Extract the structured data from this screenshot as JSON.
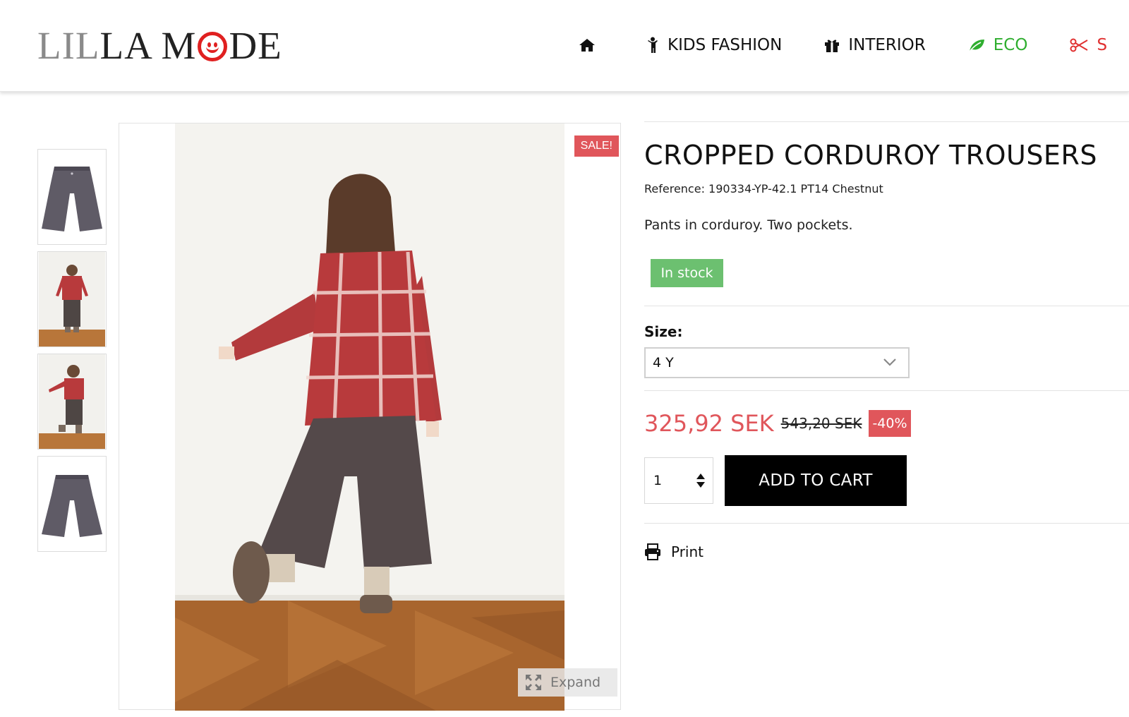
{
  "header": {
    "logo": {
      "part1": "LIL",
      "part2": "LA M",
      "part3": "DE"
    },
    "nav": [
      {
        "label": "",
        "icon": "home-icon"
      },
      {
        "label": "KIDS FASHION",
        "icon": "child-icon"
      },
      {
        "label": "INTERIOR",
        "icon": "gift-icon"
      },
      {
        "label": "ECO",
        "icon": "leaf-icon",
        "color": "#2fae2f"
      },
      {
        "label": "S",
        "icon": "scissors-icon",
        "color": "#e03030"
      }
    ]
  },
  "gallery": {
    "sale_badge": "SALE!",
    "expand_label": "Expand"
  },
  "product": {
    "title": "CROPPED CORDUROY TROUSERS",
    "reference": "Reference: 190334-YP-42.1 PT14 Chestnut",
    "description": "Pants in corduroy. Two pockets.",
    "stock_status": "In stock",
    "size_label": "Size:",
    "size_selected": "4 Y",
    "price_current": "325,92 SEK",
    "price_old": "543,20 SEK",
    "discount": "-40%",
    "quantity": "1",
    "add_to_cart_label": "ADD TO CART",
    "print_label": "Print"
  },
  "colors": {
    "accent_red": "#e0565b",
    "stock_green": "#6cc070",
    "eco_green": "#2fae2f"
  }
}
